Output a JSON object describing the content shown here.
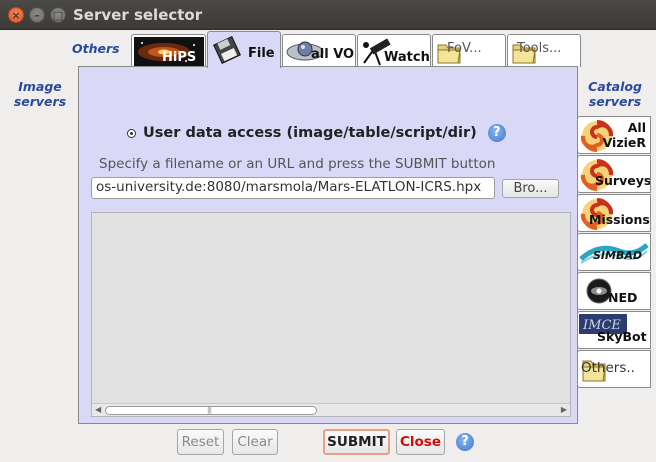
{
  "window": {
    "title": "Server selector"
  },
  "side": {
    "left_label": "Image\nservers",
    "right_label": "Catalog\nservers",
    "others_label": "Others"
  },
  "tabs": [
    {
      "label": "HiPS",
      "icon": "hips-galaxy-icon",
      "active": false
    },
    {
      "label": "File",
      "icon": "floppy-disk-icon",
      "active": true
    },
    {
      "label": "all VO",
      "icon": "vo-sphere-icon",
      "active": false
    },
    {
      "label": "Watch",
      "icon": "telescope-icon",
      "active": false
    },
    {
      "label": "FoV...",
      "icon": "folder-icon",
      "active": false
    },
    {
      "label": "Tools...",
      "icon": "folder-icon",
      "active": false
    }
  ],
  "main": {
    "radio_label": "User data access (image/table/script/dir)",
    "hint": "Specify a filename or an URL and press the SUBMIT button",
    "url_value": "os-university.de:8080/marsmola/Mars-ELATLON-ICRS.hpx",
    "browse_label": "Bro...",
    "help_glyph": "?"
  },
  "catalogs": [
    {
      "label": "All\nVizieR",
      "icon": "vizier-swirl-icon"
    },
    {
      "label": "Surveys",
      "icon": "vizier-swirl-icon"
    },
    {
      "label": "Missions",
      "icon": "vizier-swirl-icon"
    },
    {
      "label": "SIMBAD",
      "icon": "simbad-logo-icon"
    },
    {
      "label": "NED",
      "icon": "ned-logo-icon"
    },
    {
      "label": "SkyBot",
      "icon": "skybot-logo-icon"
    },
    {
      "label": "Others..",
      "icon": "folder-icon"
    }
  ],
  "buttons": {
    "reset": "Reset",
    "clear": "Clear",
    "submit": "SUBMIT",
    "close": "Close",
    "help": "?"
  },
  "colors": {
    "panel_bg": "#d9d9f7",
    "label_blue": "#2c4a9a",
    "close_red": "#d20a0a"
  }
}
